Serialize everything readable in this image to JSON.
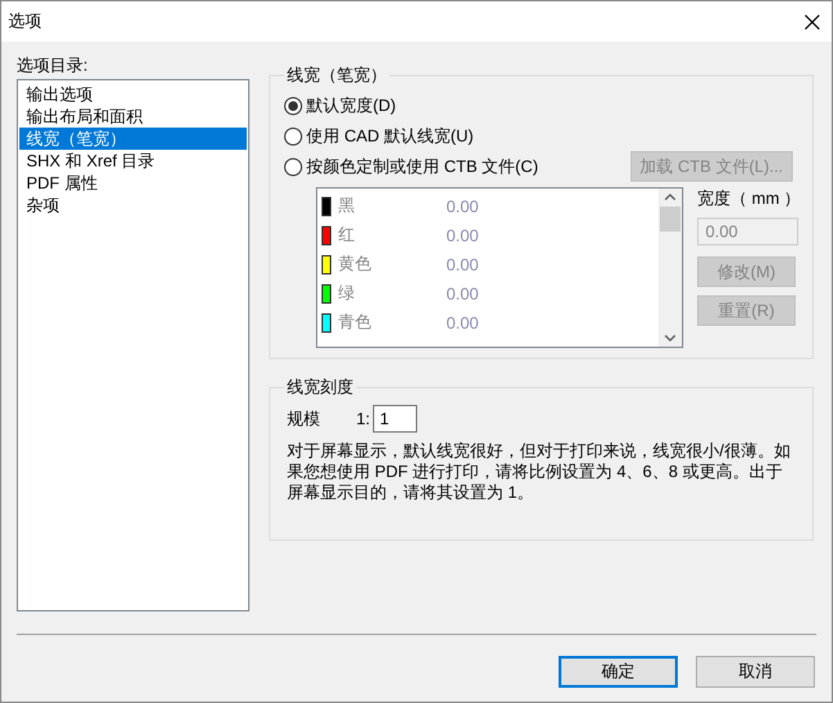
{
  "window": {
    "title": "选项"
  },
  "sidebar": {
    "label": "选项目录:",
    "items": [
      {
        "label": "输出选项",
        "selected": false
      },
      {
        "label": "输出布局和面积",
        "selected": false
      },
      {
        "label": "线宽（笔宽）",
        "selected": true
      },
      {
        "label": "SHX 和 Xref 目录",
        "selected": false
      },
      {
        "label": "PDF 属性",
        "selected": false
      },
      {
        "label": "杂项",
        "selected": false
      }
    ]
  },
  "lineweight_group": {
    "title": "线宽（笔宽）",
    "options": [
      {
        "label": "默认宽度(D)",
        "selected": true
      },
      {
        "label": "使用 CAD 默认线宽(U)",
        "selected": false
      },
      {
        "label": "按颜色定制或使用 CTB 文件(C)",
        "selected": false
      }
    ],
    "load_button": {
      "label": "加载 CTB 文件(L)...",
      "disabled": true
    },
    "colors_disabled": true,
    "colors": [
      {
        "name": "黑",
        "value": "0.00",
        "color": "#000000"
      },
      {
        "name": "红",
        "value": "0.00",
        "color": "#ff0000"
      },
      {
        "name": "黄色",
        "value": "0.00",
        "color": "#ffff00"
      },
      {
        "name": "绿",
        "value": "0.00",
        "color": "#00ff00"
      },
      {
        "name": "青色",
        "value": "0.00",
        "color": "#00ffff"
      }
    ],
    "width_label": "宽度（ mm ）",
    "width_value": "0.00",
    "modify_button": {
      "label": "修改(M)",
      "disabled": true
    },
    "reset_button": {
      "label": "重置(R)",
      "disabled": true
    }
  },
  "scale_group": {
    "title": "线宽刻度",
    "scale_label": "规模",
    "ratio_prefix": "1:",
    "ratio_value": "1",
    "note": "对于屏幕显示，默认线宽很好，但对于打印来说，线宽很小/很薄。如果您想使用 PDF 进行打印，请将比例设置为 4、6、8 或更高。出于屏幕显示目的，请将其设置为 1。"
  },
  "buttons": [
    {
      "label": "确定",
      "default": true
    },
    {
      "label": "取消",
      "default": false
    }
  ]
}
